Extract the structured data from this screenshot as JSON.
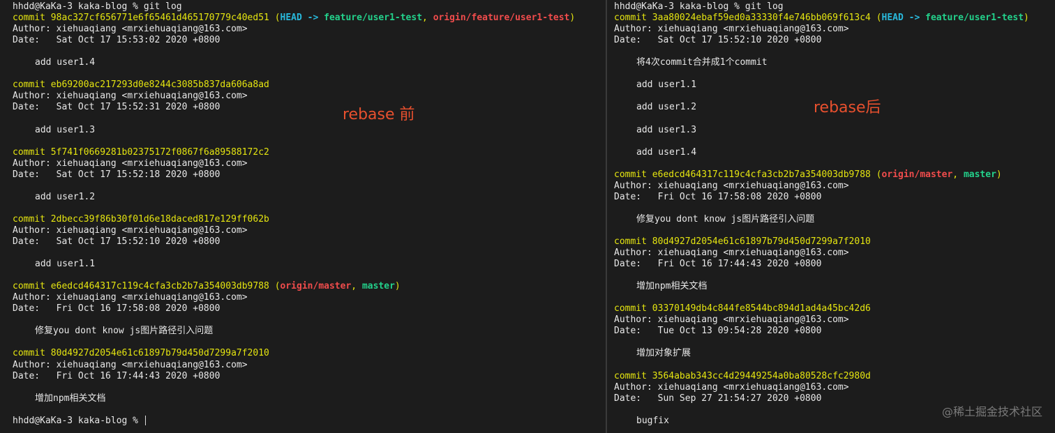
{
  "left": {
    "prompt": "hhdd@KaKa-3 kaka-blog % git log",
    "final_prompt": "hhdd@KaKa-3 kaka-blog % ",
    "label": "rebase 前",
    "commits": [
      {
        "hash": "98ac327cf656771e6f65461d465170779c40ed51",
        "open": " (",
        "head": "HEAD -> ",
        "branch": "feature/user1-test",
        "sep": ", ",
        "remote": "origin/feature/user1-test",
        "sep2": "",
        "local": "",
        "close": ")",
        "author": "Author: xiehuaqiang <mrxiehuaqiang@163.com>",
        "date": "Date:   Sat Oct 17 15:53:02 2020 +0800",
        "messages": [
          "add user1.4"
        ]
      },
      {
        "hash": "eb69200ac217293d0e8244c3085b837da606a8ad",
        "author": "Author: xiehuaqiang <mrxiehuaqiang@163.com>",
        "date": "Date:   Sat Oct 17 15:52:31 2020 +0800",
        "messages": [
          "add user1.3"
        ]
      },
      {
        "hash": "5f741f0669281b02375172f0867f6a89588172c2",
        "author": "Author: xiehuaqiang <mrxiehuaqiang@163.com>",
        "date": "Date:   Sat Oct 17 15:52:18 2020 +0800",
        "messages": [
          "add user1.2"
        ]
      },
      {
        "hash": "2dbecc39f86b30f01d6e18daced817e129ff062b",
        "author": "Author: xiehuaqiang <mrxiehuaqiang@163.com>",
        "date": "Date:   Sat Oct 17 15:52:10 2020 +0800",
        "messages": [
          "add user1.1"
        ]
      },
      {
        "hash": "e6edcd464317c119c4cfa3cb2b7a354003db9788",
        "open": " (",
        "head": "",
        "branch": "",
        "sep": "",
        "remote": "origin/master",
        "sep2": ", ",
        "local": "master",
        "close": ")",
        "author": "Author: xiehuaqiang <mrxiehuaqiang@163.com>",
        "date": "Date:   Fri Oct 16 17:58:08 2020 +0800",
        "messages": [
          "修复you dont know js图片路径引入问题"
        ]
      },
      {
        "hash": "80d4927d2054e61c61897b79d450d7299a7f2010",
        "author": "Author: xiehuaqiang <mrxiehuaqiang@163.com>",
        "date": "Date:   Fri Oct 16 17:44:43 2020 +0800",
        "messages": [
          "增加npm相关文档"
        ]
      }
    ]
  },
  "right": {
    "prompt": "hhdd@KaKa-3 kaka-blog % git log",
    "label": "rebase后",
    "watermark": "@稀土掘金技术社区",
    "commits": [
      {
        "hash": "3aa80024ebaf59ed0a33330f4e746bb069f613c4",
        "open": " (",
        "head": "HEAD -> ",
        "branch": "feature/user1-test",
        "sep": "",
        "remote": "",
        "sep2": "",
        "local": "",
        "close": ")",
        "author": "Author: xiehuaqiang <mrxiehuaqiang@163.com>",
        "date": "Date:   Sat Oct 17 15:52:10 2020 +0800",
        "messages": [
          "将4次commit合并成1个commit",
          "add user1.1",
          "add user1.2",
          "add user1.3",
          "add user1.4"
        ]
      },
      {
        "hash": "e6edcd464317c119c4cfa3cb2b7a354003db9788",
        "open": " (",
        "head": "",
        "branch": "",
        "sep": "",
        "remote": "origin/master",
        "sep2": ", ",
        "local": "master",
        "close": ")",
        "author": "Author: xiehuaqiang <mrxiehuaqiang@163.com>",
        "date": "Date:   Fri Oct 16 17:58:08 2020 +0800",
        "messages": [
          "修复you dont know js图片路径引入问题"
        ]
      },
      {
        "hash": "80d4927d2054e61c61897b79d450d7299a7f2010",
        "author": "Author: xiehuaqiang <mrxiehuaqiang@163.com>",
        "date": "Date:   Fri Oct 16 17:44:43 2020 +0800",
        "messages": [
          "增加npm相关文档"
        ]
      },
      {
        "hash": "03370149db4c844fe8544bc894d1ad4a45bc42d6",
        "author": "Author: xiehuaqiang <mrxiehuaqiang@163.com>",
        "date": "Date:   Tue Oct 13 09:54:28 2020 +0800",
        "messages": [
          "增加对象扩展"
        ]
      },
      {
        "hash": "3564abab343cc4d29449254a0ba80528cfc2980d",
        "author": "Author: xiehuaqiang <mrxiehuaqiang@163.com>",
        "date": "Date:   Sun Sep 27 21:54:27 2020 +0800",
        "messages": [
          "bugfix"
        ]
      }
    ]
  },
  "commit_word": "commit "
}
